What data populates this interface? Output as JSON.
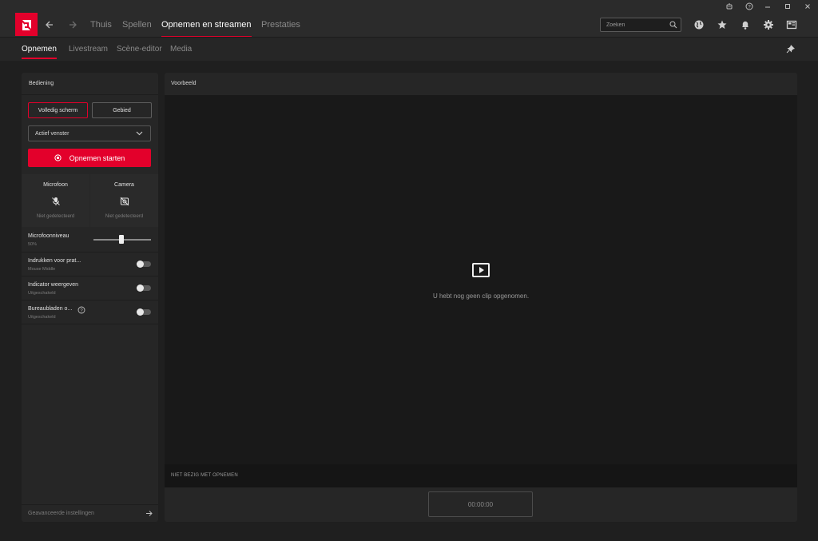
{
  "nav": {
    "tabs": [
      "Thuis",
      "Spellen",
      "Opnemen en streamen",
      "Prestaties"
    ],
    "active_tab": "Opnemen en streamen",
    "search_placeholder": "Zoeken"
  },
  "subnav": {
    "tabs": [
      "Opnemen",
      "Livestream",
      "Scène-editor",
      "Media"
    ],
    "active_tab": "Opnemen"
  },
  "controls": {
    "title": "Bediening",
    "fullscreen_label": "Volledig scherm",
    "region_label": "Gebied",
    "capture_mode": "Actief venster",
    "record_button": "Opnemen starten",
    "microphone": {
      "title": "Microfoon",
      "status": "Niet gedetecteerd"
    },
    "camera": {
      "title": "Camera",
      "status": "Niet gedetecteerd"
    },
    "mic_level": {
      "title": "Microfoonniveau",
      "value_text": "50%",
      "value": 0.5
    },
    "push_to_talk": {
      "title": "Indrukken voor prat...",
      "sub": "Mouse Middle"
    },
    "indicator": {
      "title": "Indicator weergeven",
      "sub": "Uitgeschakeld"
    },
    "desktop": {
      "title": "Bureaubladen o...",
      "sub": "Uitgeschakeld"
    },
    "advanced_label": "Geavanceerde instellingen"
  },
  "preview": {
    "title": "Voorbeeld",
    "empty_message": "U hebt nog geen clip opgenomen.",
    "status": "NIET BEZIG MET OPNEMEN",
    "timer": "00:00:00"
  },
  "colors": {
    "accent": "#e3002b",
    "panel": "#262626",
    "background": "#1f1f1f"
  },
  "icons": {
    "window": [
      "feedback-icon",
      "help-icon",
      "minimize-icon",
      "maximize-icon",
      "close-icon"
    ],
    "toolbar": [
      "globe-icon",
      "star-icon",
      "bell-icon",
      "gear-icon",
      "layout-icon"
    ]
  }
}
